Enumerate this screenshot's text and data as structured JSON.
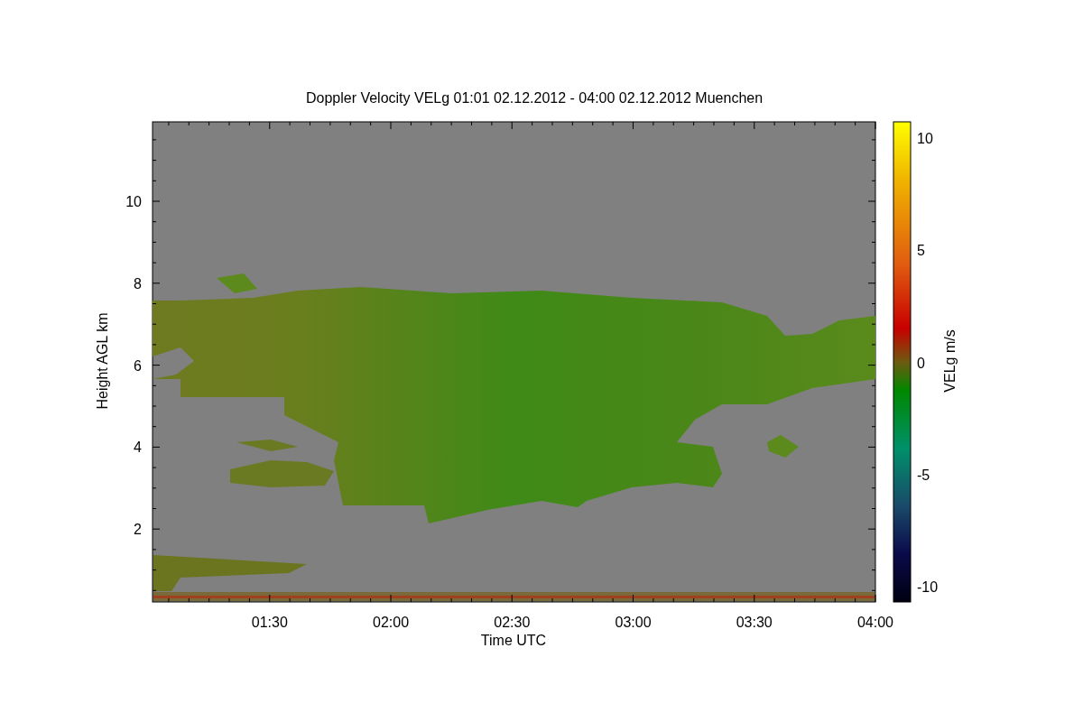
{
  "title": "Doppler Velocity VELg   01:01 02.12.2012 - 04:00 02.12.2012 Muenchen",
  "y_axis": {
    "label": "Height AGL km",
    "ticks": [
      "10",
      "8",
      "6",
      "4",
      "2"
    ]
  },
  "x_axis": {
    "label": "Time UTC",
    "ticks": [
      "01:30",
      "02:00",
      "02:30",
      "03:00",
      "03:30",
      "04:00"
    ]
  },
  "colorbar": {
    "label": "VELg m/s",
    "ticks": [
      "10",
      "5",
      "0",
      "-5",
      "-10"
    ]
  }
}
